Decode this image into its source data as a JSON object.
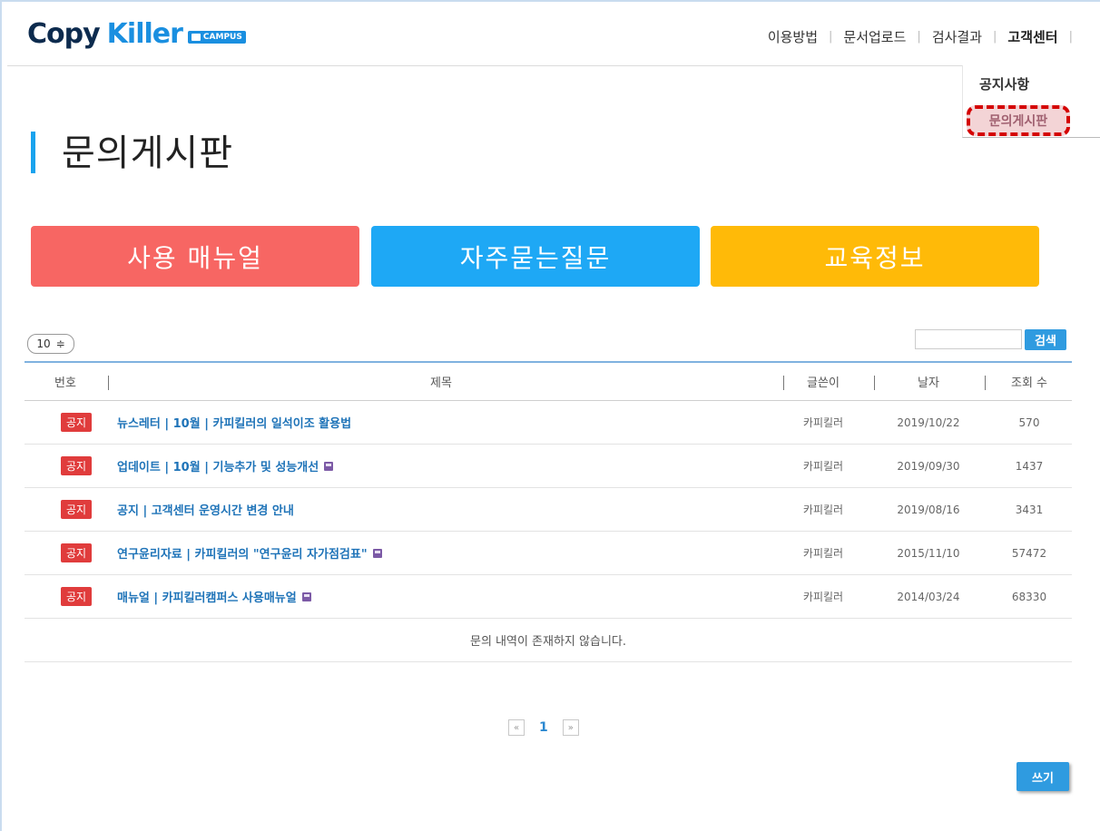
{
  "logo": {
    "copy": "Copy",
    "killer": "Killer",
    "badge": "CAMPUS"
  },
  "topnav": {
    "items": [
      "이용방법",
      "문서업로드",
      "검사결과",
      "고객센터"
    ],
    "separator": "|"
  },
  "submenu": {
    "items": [
      "공지사항",
      "문의게시판"
    ]
  },
  "page_title": "문의게시판",
  "big_buttons": [
    "사용 매뉴얼",
    "자주묻는질문",
    "교육정보"
  ],
  "controls": {
    "per_page": "10",
    "per_page_arrow": "≑",
    "search_button": "검색",
    "search_value": ""
  },
  "table": {
    "headers": {
      "no": "번호",
      "title": "제목",
      "writer": "글쓴이",
      "date": "날자",
      "views": "조회 수"
    },
    "rows": [
      {
        "badge": "공지",
        "title": "뉴스레터 | 10월 | 카피킬러의 일석이조 활용법",
        "writer": "카피킬러",
        "date": "2019/10/22",
        "views": "570"
      },
      {
        "badge": "공지",
        "title": "업데이트 | 10월 | 기능추가 및 성능개선",
        "writer": "카피킬러",
        "date": "2019/09/30",
        "views": "1437"
      },
      {
        "badge": "공지",
        "title": "공지 | 고객센터 운영시간 변경 안내",
        "writer": "카피킬러",
        "date": "2019/08/16",
        "views": "3431"
      },
      {
        "badge": "공지",
        "title": "연구윤리자료 | 카피킬러의 \"연구윤리 자가점검표\"",
        "writer": "카피킬러",
        "date": "2015/11/10",
        "views": "57472"
      },
      {
        "badge": "공지",
        "title": "매뉴얼 | 카피킬러캠퍼스 사용매뉴얼",
        "writer": "카피킬러",
        "date": "2014/03/24",
        "views": "68330"
      }
    ],
    "empty_message": "문의 내역이 존재하지 않습니다."
  },
  "pagination": {
    "prev": "«",
    "current": "1",
    "next": "»"
  },
  "write_button": "쓰기",
  "colors": {
    "red": "#f76663",
    "blue": "#1ea8f5",
    "yellow": "#ffba08",
    "accent": "#2f9be0",
    "badge": "#e03c3c"
  }
}
